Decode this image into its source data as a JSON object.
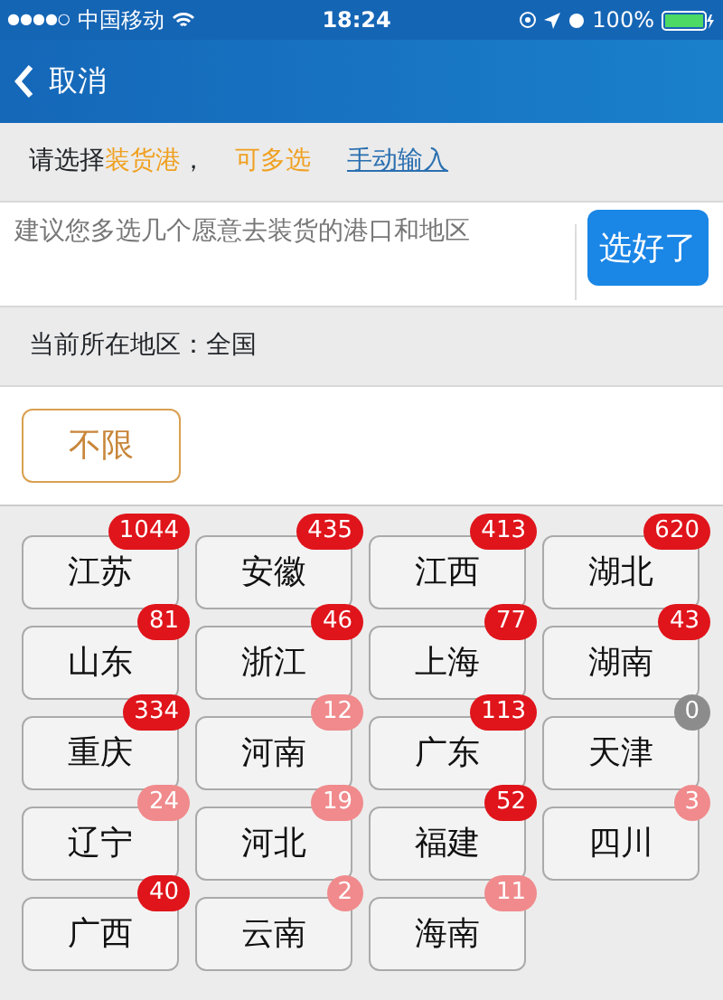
{
  "status_bar": {
    "signal": "●●●●○",
    "carrier": "中国移动",
    "time": "18:24",
    "battery": "100%"
  },
  "nav": {
    "back_label": "取消"
  },
  "prompt": {
    "text": "请选择**装货港**，",
    "multi": "可多选",
    "manual_link": "手动输入"
  },
  "input": {
    "placeholder": "建议您多选几个愿意去装货的港口和地区",
    "done_button": "选好了"
  },
  "location": {
    "text": "当前所在地区：全国"
  },
  "unlimited": {
    "label": "不限"
  },
  "regions": [
    {
      "name": "江苏",
      "count": "1044",
      "color": "#e0141b"
    },
    {
      "name": "安徽",
      "count": "435",
      "color": "#e0141b"
    },
    {
      "name": "江西",
      "count": "413",
      "color": "#e0141b"
    },
    {
      "name": "湖北",
      "count": "620",
      "color": "#e0141b"
    },
    {
      "name": "山东",
      "count": "81",
      "color": "#e0141b"
    },
    {
      "name": "浙江",
      "count": "46",
      "color": "#e0141b"
    },
    {
      "name": "上海",
      "count": "77",
      "color": "#e0141b"
    },
    {
      "name": "湖南",
      "count": "43",
      "color": "#e0141b"
    },
    {
      "name": "重庆",
      "count": "334",
      "color": "#e0141b"
    },
    {
      "name": "河南",
      "count": "12",
      "color": "#f08a8c"
    },
    {
      "name": "广东",
      "count": "113",
      "color": "#e0141b"
    },
    {
      "name": "天津",
      "count": "0",
      "color": "#8c8c8c"
    },
    {
      "name": "辽宁",
      "count": "24",
      "color": "#f08a8c"
    },
    {
      "name": "河北",
      "count": "19",
      "color": "#f08a8c"
    },
    {
      "name": "福建",
      "count": "52",
      "color": "#e0141b"
    },
    {
      "name": "四川",
      "count": "3",
      "color": "#f08a8c"
    },
    {
      "name": "广西",
      "count": "40",
      "color": "#e0141b"
    },
    {
      "name": "云南",
      "count": "2",
      "color": "#f08a8c"
    },
    {
      "name": "海南",
      "count": "11",
      "color": "#f08a8c"
    }
  ]
}
